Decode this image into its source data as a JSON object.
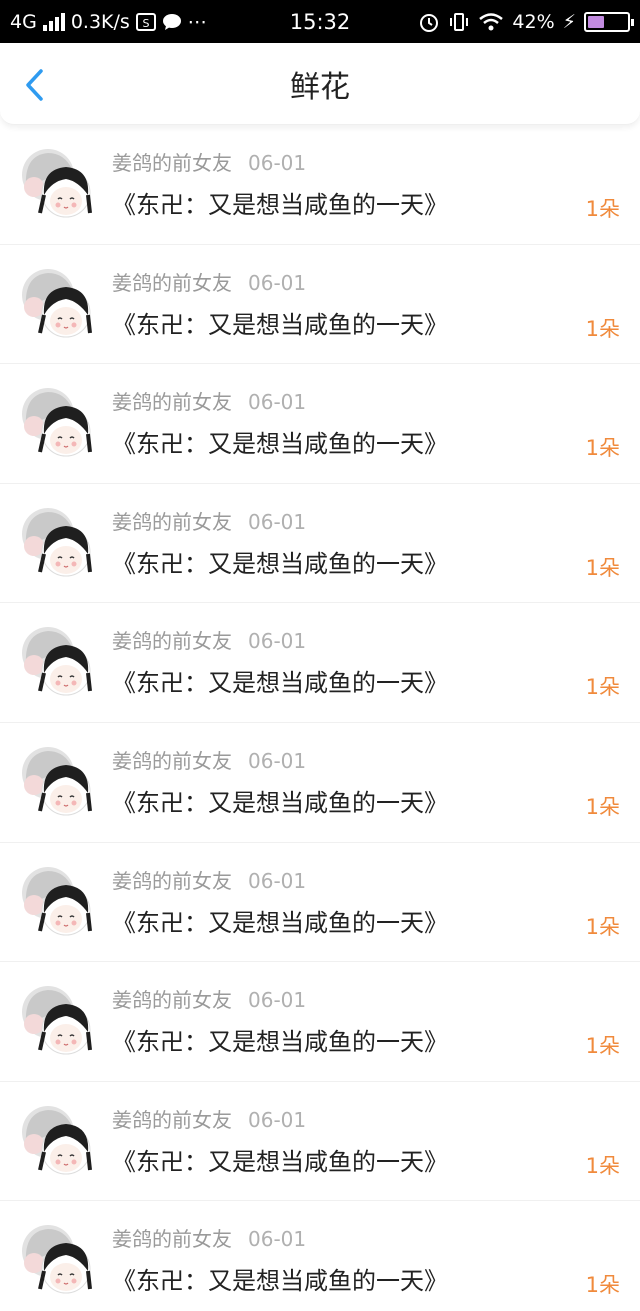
{
  "status_bar": {
    "network": "4G",
    "speed": "0.3K/s",
    "time": "15:32",
    "battery": "42%",
    "battery_level": 0.42,
    "icons": [
      "signal-icon",
      "photo-icon",
      "chat-icon",
      "more-icon",
      "alarm-icon",
      "vibrate-icon",
      "wifi-icon",
      "charging-icon",
      "battery-icon"
    ]
  },
  "nav": {
    "title": "鲜花",
    "back_icon": "chevron-left-icon",
    "accent": "#2f9bf0"
  },
  "colors": {
    "count": "#f08a3c",
    "meta": "#9a9a9a"
  },
  "items": [
    {
      "user": "姜鸽的前女友",
      "date": "06-01",
      "title": "《东卍：又是想当咸鱼的一天》",
      "count": "1朵"
    },
    {
      "user": "姜鸽的前女友",
      "date": "06-01",
      "title": "《东卍：又是想当咸鱼的一天》",
      "count": "1朵"
    },
    {
      "user": "姜鸽的前女友",
      "date": "06-01",
      "title": "《东卍：又是想当咸鱼的一天》",
      "count": "1朵"
    },
    {
      "user": "姜鸽的前女友",
      "date": "06-01",
      "title": "《东卍：又是想当咸鱼的一天》",
      "count": "1朵"
    },
    {
      "user": "姜鸽的前女友",
      "date": "06-01",
      "title": "《东卍：又是想当咸鱼的一天》",
      "count": "1朵"
    },
    {
      "user": "姜鸽的前女友",
      "date": "06-01",
      "title": "《东卍：又是想当咸鱼的一天》",
      "count": "1朵"
    },
    {
      "user": "姜鸽的前女友",
      "date": "06-01",
      "title": "《东卍：又是想当咸鱼的一天》",
      "count": "1朵"
    },
    {
      "user": "姜鸽的前女友",
      "date": "06-01",
      "title": "《东卍：又是想当咸鱼的一天》",
      "count": "1朵"
    },
    {
      "user": "姜鸽的前女友",
      "date": "06-01",
      "title": "《东卍：又是想当咸鱼的一天》",
      "count": "1朵"
    },
    {
      "user": "姜鸽的前女友",
      "date": "06-01",
      "title": "《东卍：又是想当咸鱼的一天》",
      "count": "1朵"
    }
  ]
}
